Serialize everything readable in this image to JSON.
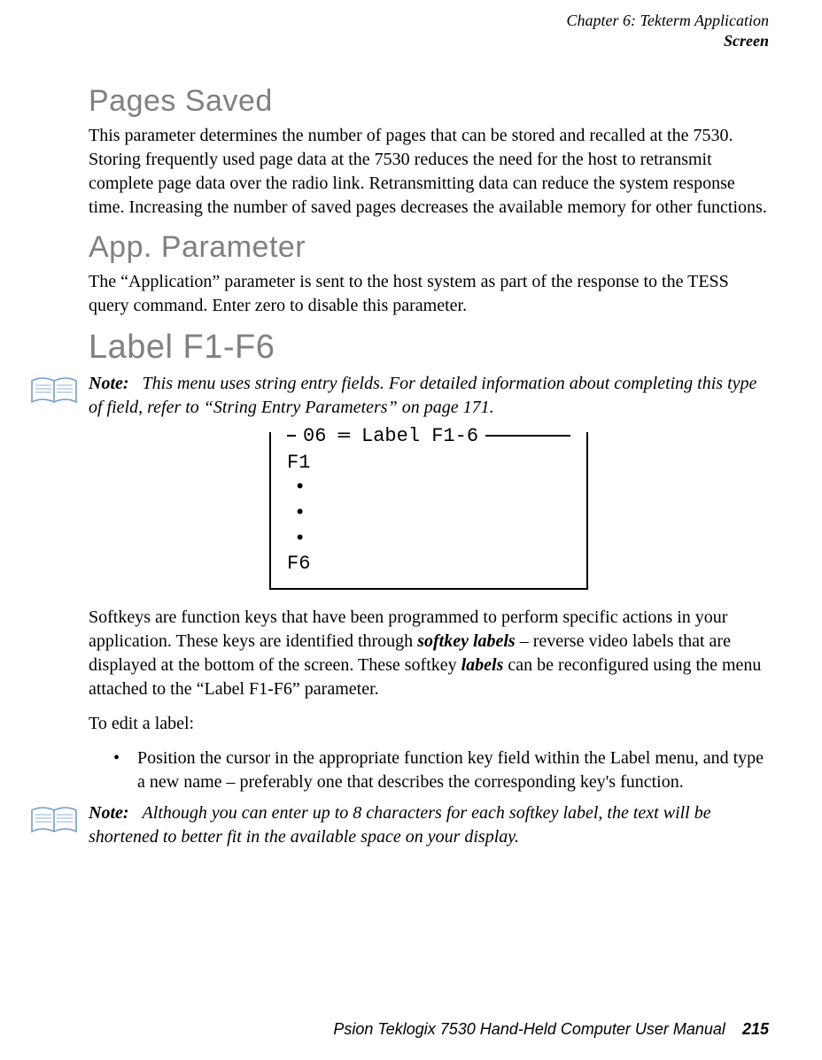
{
  "header": {
    "chapter": "Chapter 6: Tekterm Application",
    "screen": "Screen"
  },
  "sections": {
    "pages_saved": {
      "heading": "Pages Saved",
      "body": "This parameter determines the number of pages that can be stored and recalled at the 7530. Storing frequently used page data at the 7530 reduces the need for the host to retransmit complete page data over the radio link. Retransmitting data can reduce the system response time. Increasing the number of saved pages decreases the available memory for other functions."
    },
    "app_parameter": {
      "heading": "App. Parameter",
      "body": "The “Application” parameter is sent to the host system as part of the response to the TESS query command. Enter zero to disable this parameter."
    },
    "label_f1f6": {
      "heading": "Label F1-F6",
      "note1_label": "Note:",
      "note1_text": "This menu uses string entry fields. For detailed information about completing this type of field, refer to “String Entry Parameters” on page 171.",
      "diagram": {
        "legend_prefix": "06",
        "legend_title": "Label F1-6",
        "line1": "F1",
        "line2": "•",
        "line3": "•",
        "line4": "•",
        "line5": "F6"
      },
      "body1_part1": "Softkeys are function keys that have been programmed to perform specific actions in your application. These keys are identified through ",
      "body1_term1": "softkey labels",
      "body1_part2": " – reverse video labels that are displayed at the bottom of the screen. These softkey ",
      "body1_term2": "labels",
      "body1_part3": " can be reconfigured using the menu attached to the “Label F1-F6” parameter.",
      "body2": "To edit a label:",
      "bullet1": "Position the cursor in the appropriate function key field within the Label menu, and type a new name – preferably one that describes the corresponding key's function.",
      "note2_label": "Note:",
      "note2_text": "Although you can enter up to 8 characters for each softkey label, the text will be shortened to better fit in the available space on your display."
    }
  },
  "footer": {
    "text": "Psion Teklogix 7530 Hand-Held Computer User Manual",
    "page_number": "215"
  }
}
